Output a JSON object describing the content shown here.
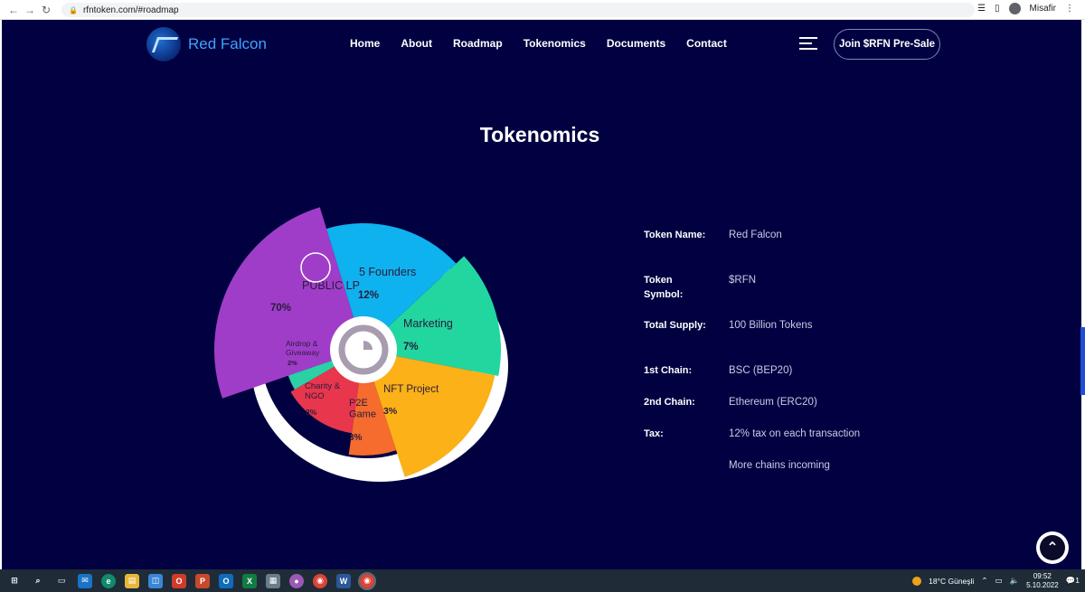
{
  "browser": {
    "url": "rfntoken.com/#roadmap",
    "profile": "Misafir",
    "nav_icons": [
      "back-arrow-icon",
      "forward-arrow-icon",
      "reload-icon"
    ]
  },
  "header": {
    "logo_text": "Red Falcon",
    "nav": [
      "Home",
      "About",
      "Roadmap",
      "Tokenomics",
      "Documents",
      "Contact"
    ],
    "cta_label": "Join $RFN Pre-Sale"
  },
  "section": {
    "title": "Tokenomics"
  },
  "chart_data": {
    "type": "pie",
    "slices": [
      {
        "label_lines": [
          "PUBLIC LP"
        ],
        "value_label": "70%",
        "value": 70,
        "color": "#a03dc8"
      },
      {
        "label_lines": [
          "5 Founders"
        ],
        "value_label": "12%",
        "value": 12,
        "color": "#0eb2ee"
      },
      {
        "label_lines": [
          "Marketing"
        ],
        "value_label": "7%",
        "value": 7,
        "color": "#22d6a0"
      },
      {
        "label_lines": [
          "NFT Project"
        ],
        "value_label": "3%",
        "value": 3,
        "color": "#fbb117"
      },
      {
        "label_lines": [
          "P2E",
          "Game"
        ],
        "value_label": "3%",
        "value": 3,
        "color": "#f66b2e"
      },
      {
        "label_lines": [
          "Charity &",
          "NGO"
        ],
        "value_label": "3%",
        "value": 3,
        "color": "#e8364c"
      },
      {
        "label_lines": [
          "Airdrop &",
          "Giveaway"
        ],
        "value_label": "2%",
        "value": 2,
        "color": "#2bd1a4"
      }
    ]
  },
  "token_info": [
    {
      "label": "Token Name:",
      "value": "Red Falcon"
    },
    {
      "label": "Token Symbol:",
      "value": "$RFN"
    },
    {
      "label": "Total Supply:",
      "value": "100 Billion Tokens"
    },
    {
      "label": "1st Chain:",
      "value": "BSC (BEP20)"
    },
    {
      "label": "2nd Chain:",
      "value": "Ethereum (ERC20)"
    },
    {
      "label": "Tax:",
      "value": "12% tax on each transaction"
    },
    {
      "label": "",
      "value": "More chains incoming"
    }
  ],
  "taskbar": {
    "weather": "18°C  Güneşli",
    "time": "09:52",
    "date": "5.10.2022",
    "notification_count": "1"
  },
  "colors": {
    "page_bg": "#010141",
    "accent_blue": "#3fa3ff"
  }
}
